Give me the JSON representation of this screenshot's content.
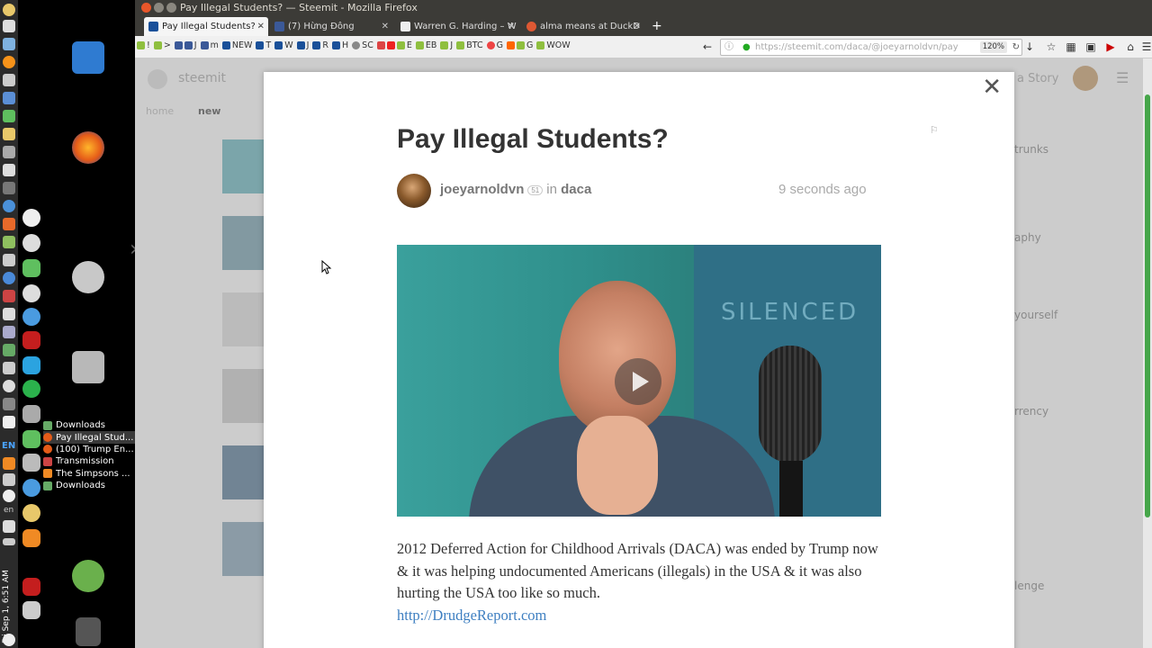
{
  "window_title": "Pay Illegal Students? — Steemit - Mozilla Firefox",
  "tabs": [
    {
      "label": "Pay Illegal Students? –",
      "active": true
    },
    {
      "label": "(7) Hừng Đông",
      "active": false
    },
    {
      "label": "Warren G. Harding – W",
      "active": false
    },
    {
      "label": "alma means at DuckD",
      "active": false
    }
  ],
  "bookmarks": [
    "!",
    ">",
    "J",
    "m",
    "NEW",
    "T",
    "W",
    "J",
    "R",
    "H",
    "SC",
    "E",
    "EB",
    "J",
    "BTC",
    "G",
    "G",
    "WOW"
  ],
  "url": "https://steemit.com/daca/@joeyarnoldvn/pay",
  "zoom": "120%",
  "taskbar": [
    {
      "label": "Downloads"
    },
    {
      "label": "Pay Illegal Stud..."
    },
    {
      "label": "(100) Trump En..."
    },
    {
      "label": "Transmission"
    },
    {
      "label": "The Simpsons ..."
    },
    {
      "label": "Downloads"
    }
  ],
  "lang_code": "EN",
  "lang_small": "en",
  "clock": "Fri Sep 1, 6:51 AM",
  "site": {
    "brand": "steemit",
    "nav_home": "home",
    "nav_new": "new",
    "header_right": "a Story",
    "side_items": [
      "trunks",
      "aphy",
      "yourself",
      "rrency",
      "lenge"
    ]
  },
  "post": {
    "title": "Pay Illegal Students?",
    "author": "joeyarnoldvn",
    "reputation": "51",
    "in": "in",
    "category": "daca",
    "time": "9 seconds ago",
    "video_poster_text": "SILENCED",
    "body": "2012 Deferred Action for Childhood Arrivals (DACA) was ended by Trump now & it was helping undocumented Americans (illegals) in the USA & it was also hurting the USA too like so much.",
    "link": "http://DrudgeReport.com"
  },
  "colors": {
    "accent_link": "#3e7fc1",
    "scroll_green": "#46a64a"
  }
}
